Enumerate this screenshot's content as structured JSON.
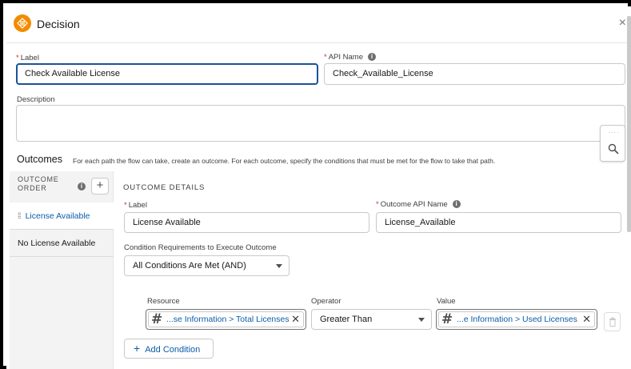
{
  "header": {
    "title": "Decision",
    "close_symbol": "×",
    "icon": "decision-icon"
  },
  "fields": {
    "label_label": "Label",
    "label_value": "Check Available License",
    "api_name_label": "API Name",
    "api_name_value": "Check_Available_License",
    "description_label": "Description",
    "description_value": ""
  },
  "outcomes": {
    "title": "Outcomes",
    "help": "For each path the flow can take, create an outcome. For each outcome, specify the conditions that must be met for the flow to take that path.",
    "order_header_line1": "OUTCOME",
    "order_header_line2": "ORDER",
    "add_symbol": "+",
    "items": [
      {
        "label": "License Available",
        "active": true
      },
      {
        "label": "No License Available",
        "active": false
      }
    ]
  },
  "details": {
    "title": "OUTCOME DETAILS",
    "label_label": "Label",
    "label_value": "License Available",
    "api_name_label": "Outcome API Name",
    "api_name_value": "License_Available",
    "cond_req_label": "Condition Requirements to Execute Outcome",
    "cond_req_value": "All Conditions Are Met (AND)",
    "condition": {
      "resource_label": "Resource",
      "resource_value": "...se Information > Total Licenses",
      "operator_label": "Operator",
      "operator_value": "Greater Than",
      "value_label": "Value",
      "value_value": "...e Information > Used Licenses"
    },
    "add_condition_label": "Add Condition"
  },
  "colors": {
    "accent": "#0b5cab",
    "focus_border": "#1b5297",
    "decision_icon": "#f28b00",
    "required": "#c23934"
  }
}
